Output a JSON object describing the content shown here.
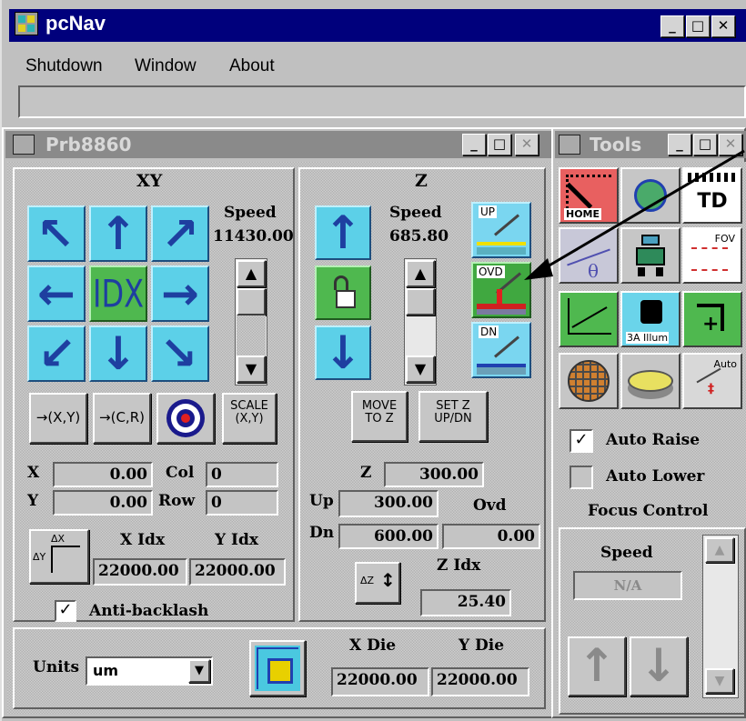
{
  "app": {
    "title": "pcNav",
    "menu": [
      "Shutdown",
      "Window",
      "About"
    ]
  },
  "prb": {
    "title": "Prb8860",
    "xy": {
      "header": "XY",
      "speed_label": "Speed",
      "speed_value": "11430.00",
      "idx_label": "IDX",
      "btn_xy": "→(X,Y)",
      "btn_cr": "→(C,R)",
      "btn_scale": "SCALE (X,Y)",
      "x_label": "X",
      "x_value": "0.00",
      "col_label": "Col",
      "col_value": "0",
      "y_label": "Y",
      "y_value": "0.00",
      "row_label": "Row",
      "row_value": "0",
      "xidx_label": "X Idx",
      "xidx_value": "22000.00",
      "yidx_label": "Y Idx",
      "yidx_value": "22000.00",
      "anti_backlash": "Anti-backlash",
      "check_mark": "✓"
    },
    "z": {
      "header": "Z",
      "speed_label": "Speed",
      "speed_value": "685.80",
      "up_icon": "UP",
      "ovd_icon": "OVD",
      "dn_icon": "DN",
      "btn_move": "MOVE TO Z",
      "btn_set": "SET Z UP/DN",
      "z_label": "Z",
      "z_value": "300.00",
      "up_label": "Up",
      "up_value": "300.00",
      "ovd_label": "Ovd",
      "dn_label": "Dn",
      "dn_value": "600.00",
      "ovd_value": "0.00",
      "zidx_label": "Z Idx",
      "zidx_value": "25.40",
      "dz": "ΔZ",
      "dx": "ΔX",
      "dy": "ΔY"
    },
    "units": {
      "label": "Units",
      "value": "um"
    },
    "die": {
      "xdie_label": "X Die",
      "ydie_label": "Y Die",
      "xdie_value": "22000.00",
      "ydie_value": "22000.00"
    }
  },
  "tools": {
    "title": "Tools",
    "home": "HOME",
    "theta": "θ",
    "td": "TD",
    "fov": "FOV",
    "illum": "3A Illum",
    "auto": "Auto",
    "auto_raise": "Auto Raise",
    "auto_lower": "Auto Lower",
    "focus_control": "Focus Control",
    "speed_label": "Speed",
    "speed_value": "N/A",
    "check_mark": "✓"
  },
  "colors": {
    "title_active": "#00007c",
    "title_inactive": "#808080",
    "button_teal": "#5cd0e8",
    "button_green": "#4fb84f"
  }
}
